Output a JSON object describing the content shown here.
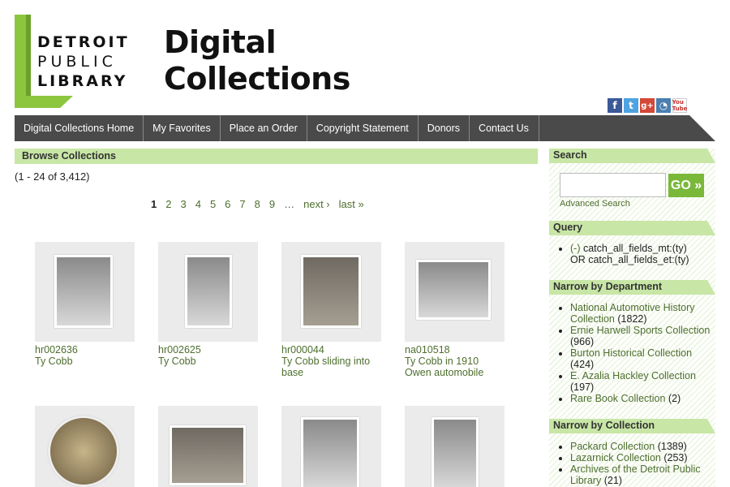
{
  "header": {
    "logo_lines": [
      "DETROIT",
      "PUBLIC",
      "LIBRARY"
    ],
    "title_lines": [
      "Digital",
      "Collections"
    ],
    "social_icons": [
      "facebook-icon",
      "twitter-icon",
      "google-plus-icon",
      "rss-icon",
      "youtube-icon"
    ],
    "social_glyphs": [
      "f",
      "t",
      "g+",
      "◔",
      "You Tube"
    ]
  },
  "nav": {
    "items": [
      "Digital Collections Home",
      "My Favorites",
      "Place an Order",
      "Copyright Statement",
      "Donors",
      "Contact Us"
    ]
  },
  "main": {
    "heading": "Browse Collections",
    "result_count": "(1 - 24 of 3,412)",
    "pager": {
      "current": "1",
      "pages": [
        "2",
        "3",
        "4",
        "5",
        "6",
        "7",
        "8",
        "9"
      ],
      "ellipsis": "…",
      "next": "next ›",
      "last": "last »"
    },
    "items": [
      {
        "id": "hr002636",
        "title": "Ty Cobb"
      },
      {
        "id": "hr002625",
        "title": "Ty Cobb"
      },
      {
        "id": "hr000044",
        "title": "Ty Cobb sliding into base"
      },
      {
        "id": "na010518",
        "title": "Ty Cobb in 1910 Owen automobile"
      },
      {
        "id": "",
        "title": ""
      },
      {
        "id": "",
        "title": ""
      },
      {
        "id": "",
        "title": ""
      },
      {
        "id": "",
        "title": ""
      }
    ]
  },
  "sidebar": {
    "search_heading": "Search",
    "go_label": "GO »",
    "advanced_search": "Advanced Search",
    "query_heading": "Query",
    "query_remove": "(-)",
    "query_text_1": "catch_all_fields_mt:(ty)",
    "query_text_2": "OR catch_all_fields_et:(ty)",
    "department_heading": "Narrow by Department",
    "departments": [
      {
        "name": "National Automotive History Collection",
        "count": "(1822)"
      },
      {
        "name": "Ernie Harwell Sports Collection",
        "count": "(966)"
      },
      {
        "name": "Burton Historical Collection",
        "count": "(424)"
      },
      {
        "name": "E. Azalia Hackley Collection",
        "count": "(197)"
      },
      {
        "name": "Rare Book Collection",
        "count": "(2)"
      }
    ],
    "collection_heading": "Narrow by Collection",
    "collections": [
      {
        "name": "Packard Collection",
        "count": "(1389)"
      },
      {
        "name": "Lazarnick Collection",
        "count": "(253)"
      },
      {
        "name": "Archives of the Detroit Public Library",
        "count": "(21)"
      }
    ]
  }
}
